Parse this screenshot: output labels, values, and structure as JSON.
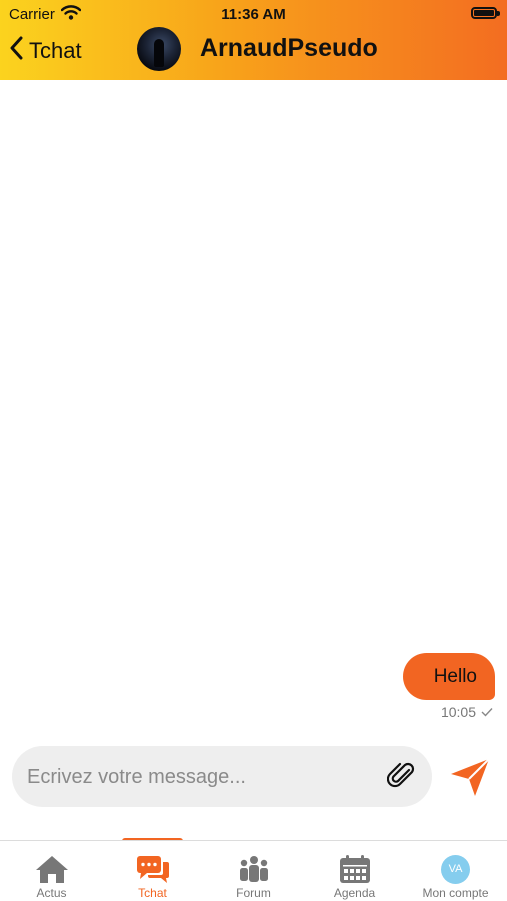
{
  "status_bar": {
    "carrier": "Carrier",
    "time": "11:36 AM"
  },
  "header": {
    "back_label": "Tchat",
    "contact_name": "ArnaudPseudo"
  },
  "messages": [
    {
      "text": "Hello",
      "time": "10:05",
      "status": "sent-check",
      "direction": "outgoing"
    }
  ],
  "composer": {
    "placeholder": "Ecrivez votre message..."
  },
  "tabs": [
    {
      "label": "Actus",
      "icon": "home-icon"
    },
    {
      "label": "Tchat",
      "icon": "chat-icon",
      "active": true
    },
    {
      "label": "Forum",
      "icon": "group-icon"
    },
    {
      "label": "Agenda",
      "icon": "calendar-icon"
    },
    {
      "label": "Mon compte",
      "icon": "avatar",
      "initials": "VA"
    }
  ],
  "colors": {
    "accent": "#f26522",
    "header_start": "#fbd31e",
    "header_end": "#f36d21"
  }
}
